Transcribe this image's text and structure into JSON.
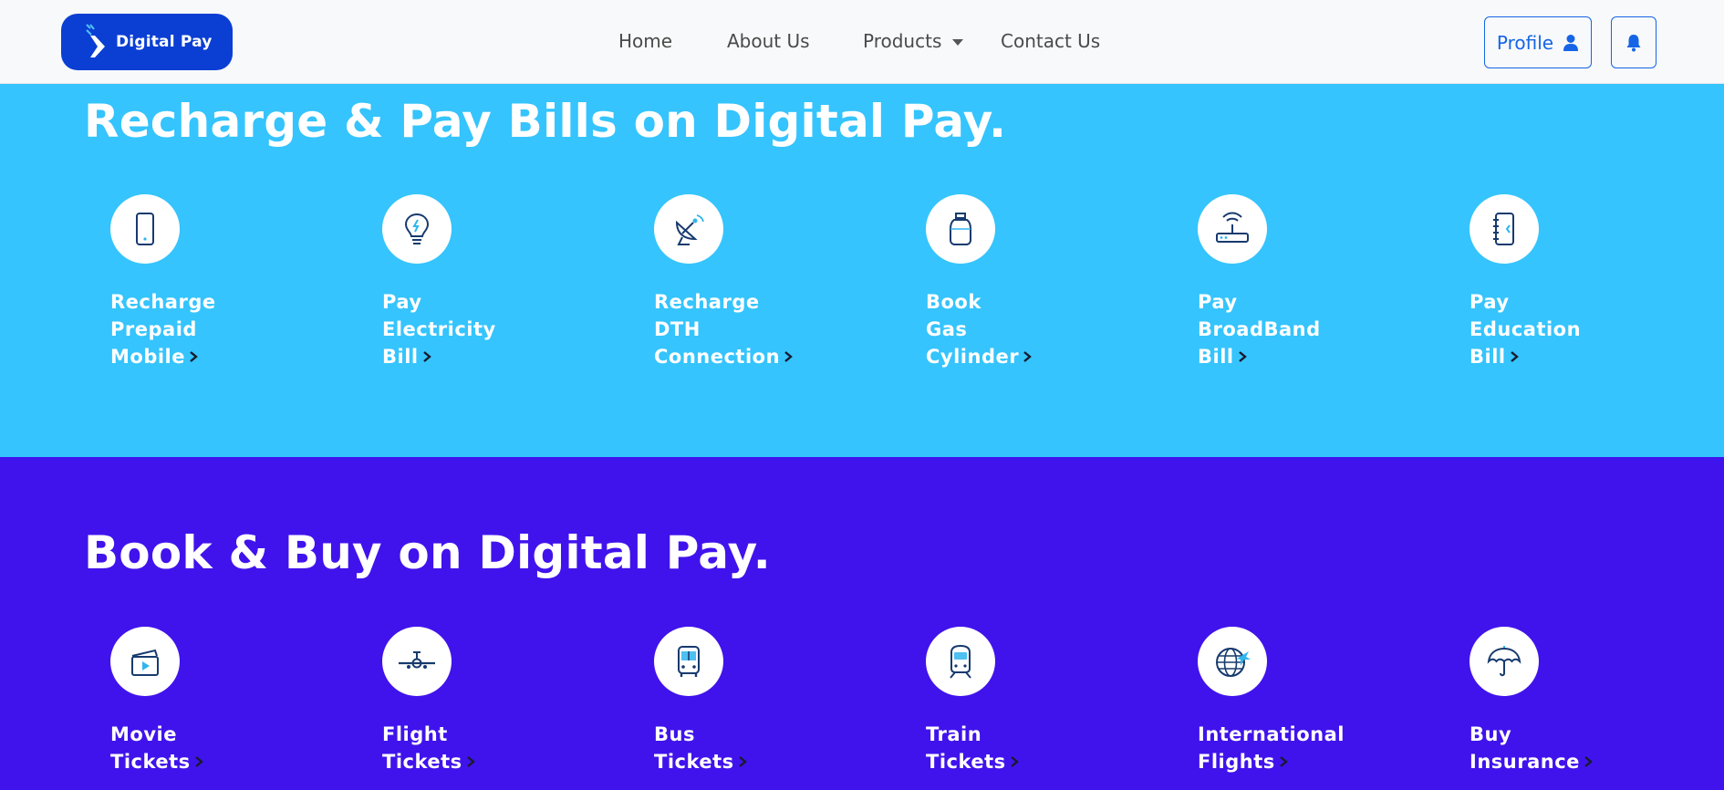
{
  "brand": {
    "name": "Digital Pay"
  },
  "nav": {
    "home": "Home",
    "about": "About Us",
    "products": "Products",
    "contact": "Contact Us"
  },
  "header": {
    "profile_label": "Profile"
  },
  "recharge": {
    "title": "Recharge & Pay Bills on Digital Pay.",
    "items": [
      {
        "line1": "Recharge",
        "line2": "Prepaid",
        "line3": "Mobile",
        "icon": "mobile-phone-icon"
      },
      {
        "line1": "Pay",
        "line2": "Electricity",
        "line3": "Bill",
        "icon": "lightbulb-icon"
      },
      {
        "line1": "Recharge",
        "line2": "DTH",
        "line3": "Connection",
        "icon": "satellite-dish-icon"
      },
      {
        "line1": "Book",
        "line2": "Gas",
        "line3": "Cylinder",
        "icon": "gas-cylinder-icon"
      },
      {
        "line1": "Pay",
        "line2": "BroadBand",
        "line3": "Bill",
        "icon": "router-icon"
      },
      {
        "line1": "Pay",
        "line2": "Education",
        "line3": "Bill",
        "icon": "notebook-icon"
      }
    ]
  },
  "book": {
    "title": "Book & Buy on Digital Pay.",
    "items": [
      {
        "line1": "Movie",
        "line2": "Tickets",
        "icon": "clapperboard-icon"
      },
      {
        "line1": "Flight",
        "line2": "Tickets",
        "icon": "airplane-icon"
      },
      {
        "line1": "Bus",
        "line2": "Tickets",
        "icon": "bus-icon"
      },
      {
        "line1": "Train",
        "line2": "Tickets",
        "icon": "train-icon"
      },
      {
        "line1": "International",
        "line2": "Flights",
        "icon": "globe-plane-icon"
      },
      {
        "line1": "Buy",
        "line2": "Insurance",
        "icon": "umbrella-icon"
      }
    ]
  },
  "colors": {
    "nav_bg": "#f8f9fa",
    "brand_blue": "#0b3fd3",
    "accent_blue": "#1565e6",
    "recharge_bg": "#35c4fd",
    "book_bg": "#4013ec",
    "icon_stroke": "#173a6e",
    "icon_accent": "#2fb5ef"
  }
}
